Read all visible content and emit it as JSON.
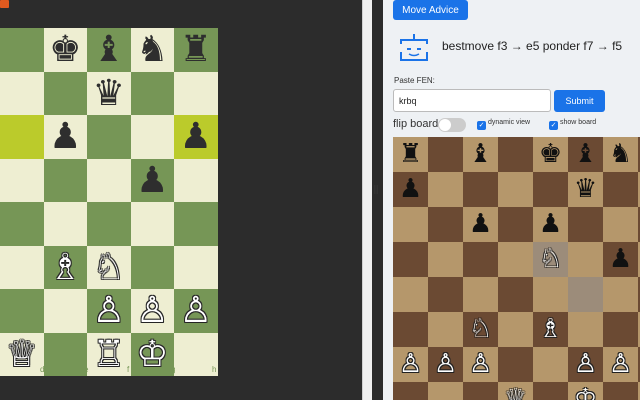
{
  "left_panel": {
    "file_labels": [
      "d",
      "e",
      "f",
      "g",
      "h"
    ],
    "pieces": [
      {
        "col": 1,
        "row": 0,
        "glyph": "♚",
        "color": "b",
        "name": "black-king-icon"
      },
      {
        "col": 2,
        "row": 0,
        "glyph": "♝",
        "color": "b",
        "name": "black-bishop-icon"
      },
      {
        "col": 3,
        "row": 0,
        "glyph": "♞",
        "color": "b",
        "name": "black-knight-icon"
      },
      {
        "col": 4,
        "row": 0,
        "glyph": "♜",
        "color": "b",
        "name": "black-rook-icon"
      },
      {
        "col": 2,
        "row": 1,
        "glyph": "♛",
        "color": "b",
        "name": "black-queen-icon"
      },
      {
        "col": 1,
        "row": 2,
        "glyph": "♟",
        "color": "b",
        "name": "black-pawn-icon"
      },
      {
        "col": 4,
        "row": 2,
        "glyph": "♟",
        "color": "b",
        "name": "black-pawn-icon"
      },
      {
        "col": 3,
        "row": 3,
        "glyph": "♟",
        "color": "b",
        "name": "black-pawn-icon"
      },
      {
        "col": 1,
        "row": 5,
        "glyph": "♗",
        "color": "w",
        "name": "white-bishop-icon"
      },
      {
        "col": 2,
        "row": 5,
        "glyph": "♘",
        "color": "w",
        "name": "white-knight-icon"
      },
      {
        "col": 2,
        "row": 6,
        "glyph": "♙",
        "color": "w",
        "name": "white-pawn-icon"
      },
      {
        "col": 3,
        "row": 6,
        "glyph": "♙",
        "color": "w",
        "name": "white-pawn-icon"
      },
      {
        "col": 4,
        "row": 6,
        "glyph": "♙",
        "color": "w",
        "name": "white-pawn-icon"
      },
      {
        "col": 0,
        "row": 7,
        "glyph": "♕",
        "color": "w",
        "name": "white-queen-icon"
      },
      {
        "col": 2,
        "row": 7,
        "glyph": "♖",
        "color": "w",
        "name": "white-rook-icon"
      },
      {
        "col": 3,
        "row": 7,
        "glyph": "♔",
        "color": "w",
        "name": "white-king-icon"
      }
    ],
    "highlights": [
      {
        "col": 0,
        "row": 2
      },
      {
        "col": 4,
        "row": 2
      }
    ],
    "colors": {
      "light": "#eeeed2",
      "dark": "#769656"
    }
  },
  "right_panel": {
    "move_advice_label": "Move Advice",
    "bestmove_text": "bestmove f3 → e5 ponder f7 → f5",
    "fen_label": "Paste FEN:",
    "fen_value": "krbq",
    "submit_label": "Submit",
    "flip_board_label": "flip board",
    "flip_board_on": false,
    "dynamic_view_label": "dynamic view",
    "dynamic_view_checked": true,
    "show_board_label": "show board",
    "show_board_checked": true,
    "accent_color": "#1a73e8",
    "pieces": [
      {
        "col": 0,
        "row": 0,
        "glyph": "♜",
        "color": "b",
        "name": "black-rook-icon"
      },
      {
        "col": 2,
        "row": 0,
        "glyph": "♝",
        "color": "b",
        "name": "black-bishop-icon"
      },
      {
        "col": 4,
        "row": 0,
        "glyph": "♚",
        "color": "b",
        "name": "black-king-icon"
      },
      {
        "col": 5,
        "row": 0,
        "glyph": "♝",
        "color": "b",
        "name": "black-bishop-icon"
      },
      {
        "col": 6,
        "row": 0,
        "glyph": "♞",
        "color": "b",
        "name": "black-knight-icon"
      },
      {
        "col": 0,
        "row": 1,
        "glyph": "♟",
        "color": "b",
        "name": "black-pawn-icon"
      },
      {
        "col": 5,
        "row": 1,
        "glyph": "♛",
        "color": "b",
        "name": "black-queen-icon"
      },
      {
        "col": 2,
        "row": 2,
        "glyph": "♟",
        "color": "b",
        "name": "black-pawn-icon"
      },
      {
        "col": 4,
        "row": 2,
        "glyph": "♟",
        "color": "b",
        "name": "black-pawn-icon"
      },
      {
        "col": 4,
        "row": 3,
        "glyph": "♘",
        "color": "w",
        "name": "white-knight-icon"
      },
      {
        "col": 6,
        "row": 3,
        "glyph": "♟",
        "color": "b",
        "name": "black-pawn-icon"
      },
      {
        "col": 2,
        "row": 5,
        "glyph": "♘",
        "color": "w",
        "name": "white-knight-icon"
      },
      {
        "col": 4,
        "row": 5,
        "glyph": "♗",
        "color": "w",
        "name": "white-bishop-icon"
      },
      {
        "col": 0,
        "row": 6,
        "glyph": "♙",
        "color": "w",
        "name": "white-pawn-icon"
      },
      {
        "col": 1,
        "row": 6,
        "glyph": "♙",
        "color": "w",
        "name": "white-pawn-icon"
      },
      {
        "col": 2,
        "row": 6,
        "glyph": "♙",
        "color": "w",
        "name": "white-pawn-icon"
      },
      {
        "col": 5,
        "row": 6,
        "glyph": "♙",
        "color": "w",
        "name": "white-pawn-icon"
      },
      {
        "col": 6,
        "row": 6,
        "glyph": "♙",
        "color": "w",
        "name": "white-pawn-icon"
      },
      {
        "col": 3,
        "row": 7,
        "glyph": "♕",
        "color": "w",
        "name": "white-queen-icon"
      },
      {
        "col": 5,
        "row": 7,
        "glyph": "♔",
        "color": "w",
        "name": "white-king-icon"
      }
    ],
    "highlights": [
      {
        "col": 4,
        "row": 3
      },
      {
        "col": 5,
        "row": 4
      }
    ],
    "colors": {
      "light": "#b5976b",
      "dark": "#6b4a33"
    }
  }
}
